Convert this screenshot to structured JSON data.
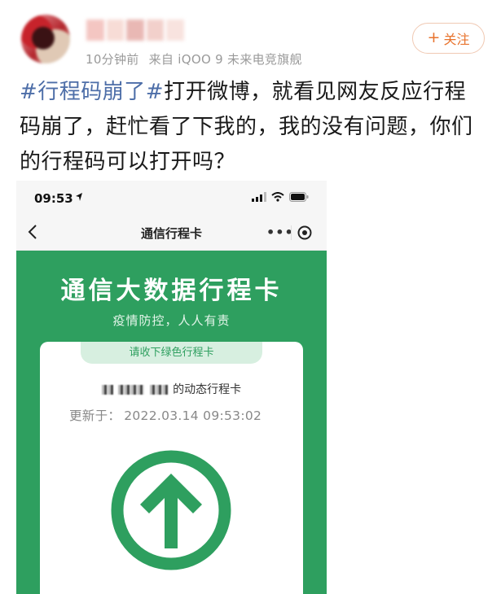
{
  "post": {
    "meta_time": "10分钟前",
    "meta_source": "来自 iQOO 9 未来电竞旗舰",
    "follow_label": "关注",
    "text_tag": "#行程码崩了#",
    "text_body": "打开微博，就看见网友反应行程码崩了，赶忙看了下我的，我的没有问题，你们的行程码可以打开吗？"
  },
  "phone": {
    "status_time": "09:53",
    "nav_title": "通信行程卡",
    "nav_more": "•••",
    "card_title": "通信大数据行程卡",
    "card_subtitle": "疫情防控，人人有责",
    "card_tab": "请收下绿色行程卡",
    "owner_suffix": "的动态行程卡",
    "update_label": "更新于：",
    "update_value": "2022.03.14 09:53:02"
  },
  "colors": {
    "green": "#2e9f5f",
    "accent_orange": "#e8732d",
    "hashtag_blue": "#4d6ea8"
  },
  "icons": [
    "location-arrow-icon",
    "signal-icon",
    "wifi-icon",
    "battery-icon",
    "back-chevron-icon",
    "more-icon",
    "target-icon",
    "up-arrow-circle-icon"
  ]
}
